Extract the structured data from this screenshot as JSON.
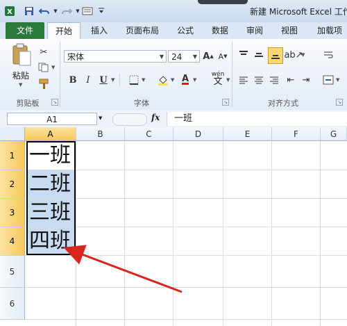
{
  "window": {
    "title": "新建 Microsoft Excel 工作",
    "quick_access": [
      "excel-logo-icon",
      "save-icon",
      "undo-icon",
      "redo-icon",
      "print-preview-icon",
      "customize-icon"
    ]
  },
  "tabs": [
    {
      "label": "文件"
    },
    {
      "label": "开始"
    },
    {
      "label": "插入"
    },
    {
      "label": "页面布局"
    },
    {
      "label": "公式"
    },
    {
      "label": "数据"
    },
    {
      "label": "审阅"
    },
    {
      "label": "视图"
    },
    {
      "label": "加载项"
    }
  ],
  "ribbon": {
    "clipboard": {
      "paste_label": "粘贴",
      "group_label": "剪贴板"
    },
    "font": {
      "font_name": "宋体",
      "font_size": "24",
      "bold": "B",
      "italic": "I",
      "underline": "U",
      "wen": "wén",
      "font_color_glyph": "A",
      "group_label": "字体"
    },
    "alignment": {
      "group_label": "对齐方式"
    }
  },
  "formula_bar": {
    "name_box": "A1",
    "fx": "fx",
    "content": "一班"
  },
  "sheet": {
    "columns": [
      "A",
      "B",
      "C",
      "D",
      "E",
      "F",
      "G"
    ],
    "rows": [
      "1",
      "2",
      "3",
      "4",
      "5",
      "6"
    ],
    "cells": {
      "A1": "一班",
      "A2": "二班",
      "A3": "三班",
      "A4": "四班"
    },
    "selection": "A1:A4"
  },
  "colors": {
    "accent": "#2a7a3c",
    "selection_fill": "#c8dcf1",
    "header_selected": "#f6c85c",
    "annotation_arrow": "#d9261c"
  }
}
